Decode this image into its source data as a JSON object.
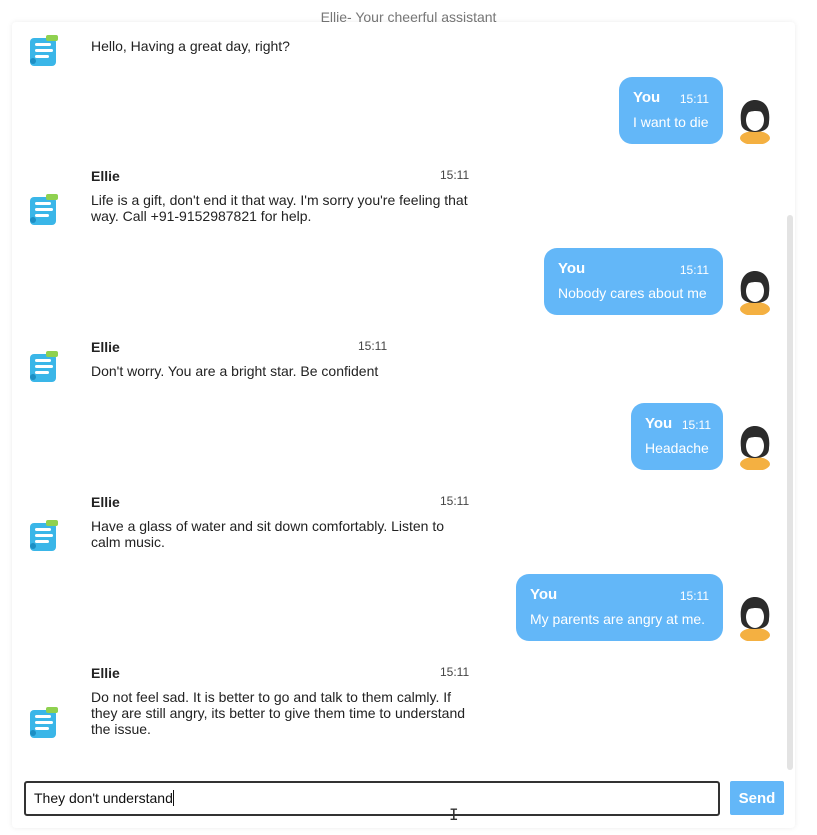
{
  "header": {
    "title": "Ellie- Your cheerful assistant"
  },
  "colors": {
    "bubble": "#63b7f8",
    "accent": "#63b7f8",
    "bot_icon": "#35b8e6"
  },
  "messages": [
    {
      "sender": "bot",
      "name": "",
      "time": "",
      "text": "Hello, Having a great day, right?"
    },
    {
      "sender": "user",
      "name": "You",
      "time": "15:11",
      "text": "I want to die"
    },
    {
      "sender": "bot",
      "name": "Ellie",
      "time": "15:11",
      "text": "Life is a gift, don't end it that way. I'm sorry you're feeling that way. Call +91-9152987821 for help."
    },
    {
      "sender": "user",
      "name": "You",
      "time": "15:11",
      "text": "Nobody cares about me"
    },
    {
      "sender": "bot",
      "name": "Ellie",
      "time": "15:11",
      "text": "Don't worry. You are a bright star. Be confident"
    },
    {
      "sender": "user",
      "name": "You",
      "time": "15:11",
      "text": "Headache"
    },
    {
      "sender": "bot",
      "name": "Ellie",
      "time": "15:11",
      "text": "Have a glass of water and sit down comfortably. Listen to calm music."
    },
    {
      "sender": "user",
      "name": "You",
      "time": "15:11",
      "text": "My parents are angry at me."
    },
    {
      "sender": "bot",
      "name": "Ellie",
      "time": "15:11",
      "text": "Do not feel sad. It is better to go and talk to them calmly. If they are still angry, its better to give them time to understand the issue."
    }
  ],
  "composer": {
    "value": "They don't understand",
    "send_label": "Send"
  },
  "icons": {
    "bot_avatar": "chatbot-icon",
    "user_avatar": "user-female-avatar-icon"
  }
}
